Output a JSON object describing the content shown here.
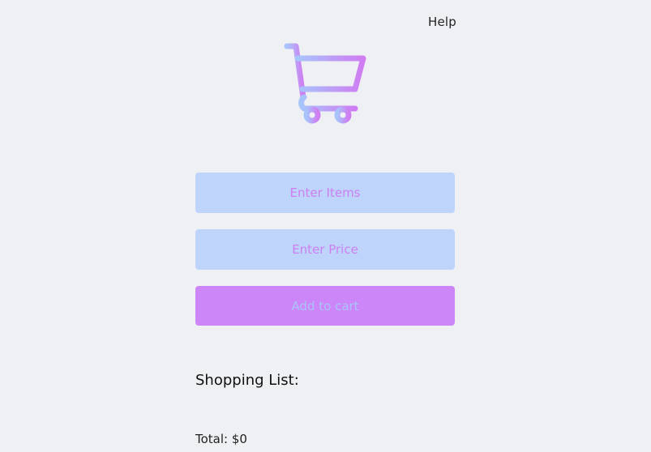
{
  "header": {
    "help_label": "Help"
  },
  "logo": {
    "icon": "shopping-cart-icon",
    "gradient_start": "#a7c5fb",
    "gradient_end": "#d07cf2"
  },
  "form": {
    "items_placeholder": "Enter Items",
    "items_value": "",
    "price_placeholder": "Enter Price",
    "price_value": "",
    "add_button_label": "Add to cart"
  },
  "list": {
    "heading": "Shopping List:",
    "items": []
  },
  "summary": {
    "total_label": "Total: $0"
  },
  "colors": {
    "background": "#eff0f4",
    "input_background": "#bed4fb",
    "input_text": "#cd7ff2",
    "button_background": "#cd86f7",
    "button_text": "#a9c4fa"
  }
}
